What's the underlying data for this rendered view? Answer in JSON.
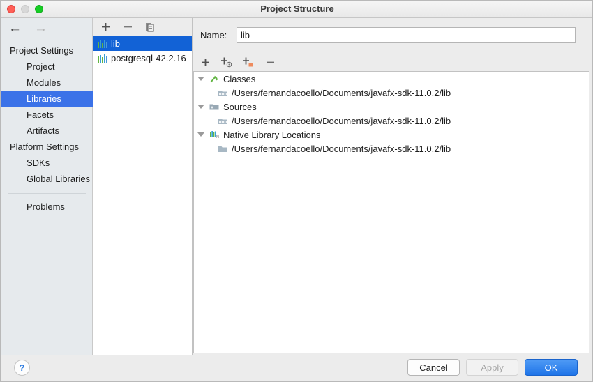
{
  "window": {
    "title": "Project Structure",
    "controls": {
      "close": "close-button",
      "minimize": "minimize-button",
      "zoom": "zoom-button"
    }
  },
  "sidebar": {
    "nav": {
      "back": "←",
      "forward": "→"
    },
    "items": [
      {
        "label": "Project Settings",
        "type": "group",
        "selected": false
      },
      {
        "label": "Project",
        "type": "child",
        "selected": false
      },
      {
        "label": "Modules",
        "type": "child",
        "selected": false
      },
      {
        "label": "Libraries",
        "type": "child",
        "selected": true
      },
      {
        "label": "Facets",
        "type": "child",
        "selected": false
      },
      {
        "label": "Artifacts",
        "type": "child",
        "selected": false
      },
      {
        "label": "Platform Settings",
        "type": "group",
        "selected": false
      },
      {
        "label": "SDKs",
        "type": "child",
        "selected": false
      },
      {
        "label": "Global Libraries",
        "type": "child",
        "selected": false
      }
    ],
    "problems": {
      "label": "Problems"
    }
  },
  "library_list": {
    "toolbar": [
      {
        "name": "add-library-button",
        "glyph": "+"
      },
      {
        "name": "remove-library-button",
        "glyph": "−"
      },
      {
        "name": "copy-library-button",
        "glyph": "copy-icon"
      }
    ],
    "items": [
      {
        "label": "lib",
        "selected": true
      },
      {
        "label": "postgresql-42.2.16",
        "selected": false
      }
    ]
  },
  "detail": {
    "name_label": "Name:",
    "name_value": "lib",
    "name_placeholder": "",
    "toolbar": [
      {
        "name": "add-root-button",
        "glyph": "+"
      },
      {
        "name": "add-classes-button",
        "glyph": "+"
      },
      {
        "name": "add-jar-directory-button",
        "glyph": "+"
      },
      {
        "name": "remove-root-button",
        "glyph": "−"
      }
    ],
    "tree": [
      {
        "label": "Classes",
        "icon": "classes-icon",
        "expanded": true,
        "children": [
          {
            "label": "/Users/fernandacoello/Documents/javafx-sdk-11.0.2/lib",
            "icon": "archive-folder-icon"
          }
        ]
      },
      {
        "label": "Sources",
        "icon": "sources-folder-icon",
        "expanded": true,
        "children": [
          {
            "label": "/Users/fernandacoello/Documents/javafx-sdk-11.0.2/lib",
            "icon": "archive-folder-icon"
          }
        ]
      },
      {
        "label": "Native Library Locations",
        "icon": "native-library-icon",
        "expanded": true,
        "children": [
          {
            "label": "/Users/fernandacoello/Documents/javafx-sdk-11.0.2/lib",
            "icon": "folder-icon"
          }
        ]
      }
    ]
  },
  "footer": {
    "help": "?",
    "cancel": "Cancel",
    "apply": "Apply",
    "ok": "OK",
    "apply_enabled": false
  },
  "colors": {
    "selection_blue": "#3b72e8",
    "list_selection_blue": "#1262d6",
    "ok_button_blue": "#1f74e8",
    "window_bg": "#ececec",
    "sidebar_bg": "#e6eaed",
    "accent_orange": "#ee8b5e",
    "classes_green": "#62b543"
  }
}
